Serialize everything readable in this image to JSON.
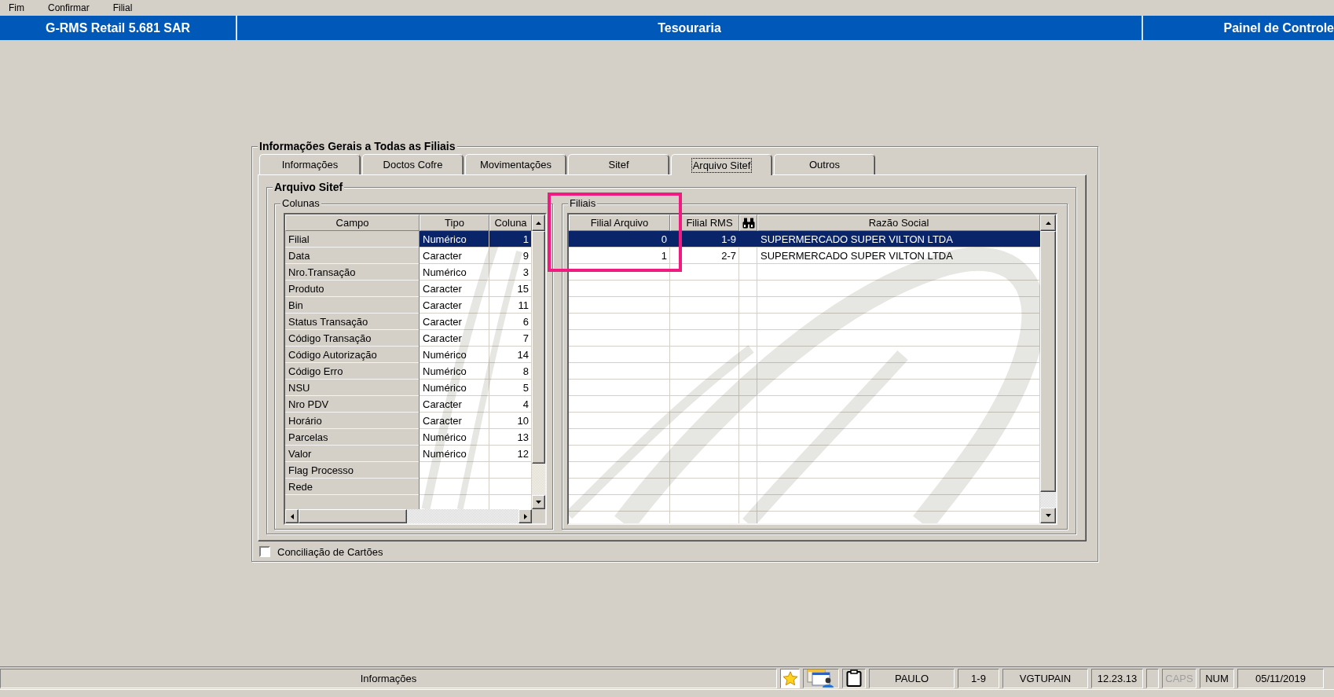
{
  "menu": [
    {
      "label": "Fim"
    },
    {
      "label": "Confirmar"
    },
    {
      "label": "Filial"
    }
  ],
  "title_bar": {
    "application": "G-RMS Retail 5.681 SAR",
    "module": "Tesouraria",
    "panel": "Painel de Controle"
  },
  "settings_group": {
    "title": "Informações Gerais a Todas as Filiais",
    "tabs": [
      {
        "label": "Informações",
        "selected": false
      },
      {
        "label": "Doctos Cofre",
        "selected": false
      },
      {
        "label": "Movimentações",
        "selected": false
      },
      {
        "label": "Sitef",
        "selected": false
      },
      {
        "label": "Arquivo Sitef",
        "selected": true
      },
      {
        "label": "Outros",
        "selected": false
      }
    ],
    "panel": {
      "title": "Arquivo Sitef",
      "columns_group": {
        "title": "Colunas",
        "table": {
          "columns": [
            "Campo",
            "Tipo",
            "Coluna"
          ],
          "rows": [
            {
              "campo": "Filial",
              "tipo": "Numérico",
              "coluna": "1",
              "selected": true
            },
            {
              "campo": "Data",
              "tipo": "Caracter",
              "coluna": "9",
              "selected": false
            },
            {
              "campo": "Nro.Transação",
              "tipo": "Numérico",
              "coluna": "3",
              "selected": false
            },
            {
              "campo": "Produto",
              "tipo": "Caracter",
              "coluna": "15",
              "selected": false
            },
            {
              "campo": "Bin",
              "tipo": "Caracter",
              "coluna": "11",
              "selected": false
            },
            {
              "campo": "Status Transação",
              "tipo": "Caracter",
              "coluna": "6",
              "selected": false
            },
            {
              "campo": "Código Transação",
              "tipo": "Caracter",
              "coluna": "7",
              "selected": false
            },
            {
              "campo": "Código Autorização",
              "tipo": "Numérico",
              "coluna": "14",
              "selected": false
            },
            {
              "campo": "Código Erro",
              "tipo": "Numérico",
              "coluna": "8",
              "selected": false
            },
            {
              "campo": "NSU",
              "tipo": "Numérico",
              "coluna": "5",
              "selected": false
            },
            {
              "campo": "Nro PDV",
              "tipo": "Caracter",
              "coluna": "4",
              "selected": false
            },
            {
              "campo": "Horário",
              "tipo": "Caracter",
              "coluna": "10",
              "selected": false
            },
            {
              "campo": "Parcelas",
              "tipo": "Numérico",
              "coluna": "13",
              "selected": false
            },
            {
              "campo": "Valor",
              "tipo": "Numérico",
              "coluna": "12",
              "selected": false
            },
            {
              "campo": "Flag Processo",
              "selected": false
            },
            {
              "campo": "Rede",
              "selected": false
            }
          ]
        }
      },
      "branches_group": {
        "title": "Filiais",
        "table": {
          "columns": [
            {
              "kind": "text",
              "label": "Filial Arquivo"
            },
            {
              "kind": "text",
              "label": "Filial RMS"
            },
            {
              "kind": "icon"
            },
            {
              "kind": "text",
              "label": "Razão Social"
            }
          ],
          "rows": [
            {
              "filial_arquivo": "0",
              "filial_rms": "1-9",
              "razao_social": "SUPERMERCADO SUPER VILTON LTDA",
              "selected": true
            },
            {
              "filial_arquivo": "1",
              "filial_rms": "2-7",
              "razao_social": "SUPERMERCADO SUPER VILTON LTDA",
              "selected": false
            }
          ]
        }
      }
    },
    "checkbox": {
      "label": "Conciliação de Cartões",
      "checked": false
    }
  },
  "status_bar": {
    "message": "Informações",
    "user": "PAULO",
    "branch": "1-9",
    "workstation": "VGTUPAIN",
    "time": "12.23.13",
    "indicators": [
      {
        "label": "CAPS",
        "on": false
      },
      {
        "label": "NUM",
        "on": true
      }
    ],
    "date": "05/11/2019"
  }
}
